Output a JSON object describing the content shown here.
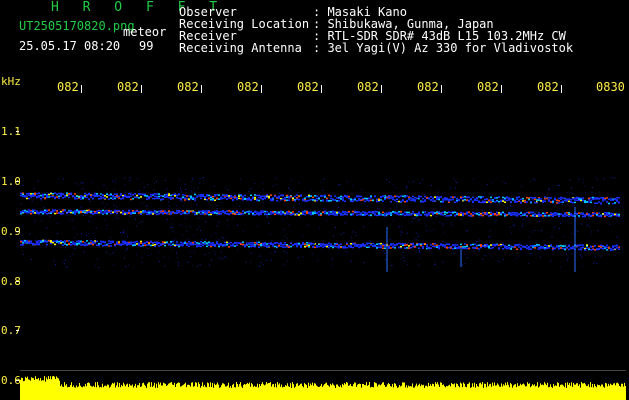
{
  "header": {
    "program": "H R O F F T",
    "filename": "UT2505170820.png",
    "mode": "meteor",
    "datetime": "25.05.17 08:20",
    "count": "99",
    "fields": [
      {
        "label": "Observer",
        "value": ": Masaki Kano"
      },
      {
        "label": "Receiving Location",
        "value": ": Shibukawa, Gunma, Japan"
      },
      {
        "label": "Receiver",
        "value": ": RTL-SDR SDR# 43dB L15 103.2MHz CW"
      },
      {
        "label": "Receiving Antenna",
        "value": ": 3el Yagi(V) Az 330 for Vladivostok"
      }
    ]
  },
  "axes": {
    "y_unit": "kHz",
    "y_ticks": [
      "1.1",
      "1.0",
      "0.9",
      "0.8",
      "0.7",
      "0.6"
    ],
    "x_ticks": [
      "082",
      "082",
      "082",
      "082",
      "082",
      "082",
      "082",
      "082",
      "082",
      "0830"
    ]
  },
  "colors": {
    "accent": "#22cc44",
    "axis_text": "#ffee44",
    "info_text": "#ffffff",
    "signal_blue": "#1a2fff",
    "signal_hot": "#ff4400",
    "signal_yellow": "#ffff00",
    "noise_floor": "#ffff00"
  }
}
